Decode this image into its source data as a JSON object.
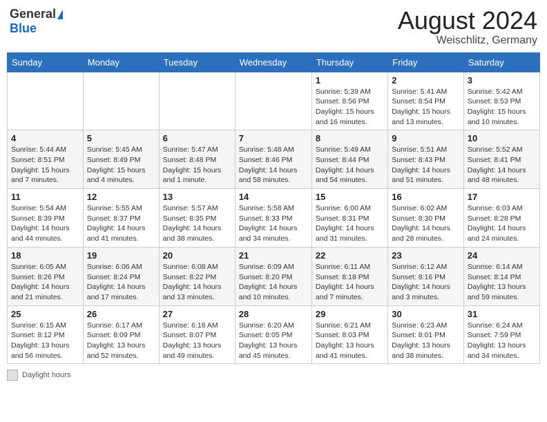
{
  "header": {
    "logo_general": "General",
    "logo_blue": "Blue",
    "month_year": "August 2024",
    "location": "Weischlitz, Germany"
  },
  "footer": {
    "daylight_label": "Daylight hours"
  },
  "weekdays": [
    "Sunday",
    "Monday",
    "Tuesday",
    "Wednesday",
    "Thursday",
    "Friday",
    "Saturday"
  ],
  "weeks": [
    [
      {
        "day": "",
        "sunrise": "",
        "sunset": "",
        "daylight": ""
      },
      {
        "day": "",
        "sunrise": "",
        "sunset": "",
        "daylight": ""
      },
      {
        "day": "",
        "sunrise": "",
        "sunset": "",
        "daylight": ""
      },
      {
        "day": "",
        "sunrise": "",
        "sunset": "",
        "daylight": ""
      },
      {
        "day": "1",
        "sunrise": "5:39 AM",
        "sunset": "8:56 PM",
        "daylight": "15 hours and 16 minutes."
      },
      {
        "day": "2",
        "sunrise": "5:41 AM",
        "sunset": "8:54 PM",
        "daylight": "15 hours and 13 minutes."
      },
      {
        "day": "3",
        "sunrise": "5:42 AM",
        "sunset": "8:53 PM",
        "daylight": "15 hours and 10 minutes."
      }
    ],
    [
      {
        "day": "4",
        "sunrise": "5:44 AM",
        "sunset": "8:51 PM",
        "daylight": "15 hours and 7 minutes."
      },
      {
        "day": "5",
        "sunrise": "5:45 AM",
        "sunset": "8:49 PM",
        "daylight": "15 hours and 4 minutes."
      },
      {
        "day": "6",
        "sunrise": "5:47 AM",
        "sunset": "8:48 PM",
        "daylight": "15 hours and 1 minute."
      },
      {
        "day": "7",
        "sunrise": "5:48 AM",
        "sunset": "8:46 PM",
        "daylight": "14 hours and 58 minutes."
      },
      {
        "day": "8",
        "sunrise": "5:49 AM",
        "sunset": "8:44 PM",
        "daylight": "14 hours and 54 minutes."
      },
      {
        "day": "9",
        "sunrise": "5:51 AM",
        "sunset": "8:43 PM",
        "daylight": "14 hours and 51 minutes."
      },
      {
        "day": "10",
        "sunrise": "5:52 AM",
        "sunset": "8:41 PM",
        "daylight": "14 hours and 48 minutes."
      }
    ],
    [
      {
        "day": "11",
        "sunrise": "5:54 AM",
        "sunset": "8:39 PM",
        "daylight": "14 hours and 44 minutes."
      },
      {
        "day": "12",
        "sunrise": "5:55 AM",
        "sunset": "8:37 PM",
        "daylight": "14 hours and 41 minutes."
      },
      {
        "day": "13",
        "sunrise": "5:57 AM",
        "sunset": "8:35 PM",
        "daylight": "14 hours and 38 minutes."
      },
      {
        "day": "14",
        "sunrise": "5:58 AM",
        "sunset": "8:33 PM",
        "daylight": "14 hours and 34 minutes."
      },
      {
        "day": "15",
        "sunrise": "6:00 AM",
        "sunset": "8:31 PM",
        "daylight": "14 hours and 31 minutes."
      },
      {
        "day": "16",
        "sunrise": "6:02 AM",
        "sunset": "8:30 PM",
        "daylight": "14 hours and 28 minutes."
      },
      {
        "day": "17",
        "sunrise": "6:03 AM",
        "sunset": "8:28 PM",
        "daylight": "14 hours and 24 minutes."
      }
    ],
    [
      {
        "day": "18",
        "sunrise": "6:05 AM",
        "sunset": "8:26 PM",
        "daylight": "14 hours and 21 minutes."
      },
      {
        "day": "19",
        "sunrise": "6:06 AM",
        "sunset": "8:24 PM",
        "daylight": "14 hours and 17 minutes."
      },
      {
        "day": "20",
        "sunrise": "6:08 AM",
        "sunset": "8:22 PM",
        "daylight": "14 hours and 13 minutes."
      },
      {
        "day": "21",
        "sunrise": "6:09 AM",
        "sunset": "8:20 PM",
        "daylight": "14 hours and 10 minutes."
      },
      {
        "day": "22",
        "sunrise": "6:11 AM",
        "sunset": "8:18 PM",
        "daylight": "14 hours and 7 minutes."
      },
      {
        "day": "23",
        "sunrise": "6:12 AM",
        "sunset": "8:16 PM",
        "daylight": "14 hours and 3 minutes."
      },
      {
        "day": "24",
        "sunrise": "6:14 AM",
        "sunset": "8:14 PM",
        "daylight": "13 hours and 59 minutes."
      }
    ],
    [
      {
        "day": "25",
        "sunrise": "6:15 AM",
        "sunset": "8:12 PM",
        "daylight": "13 hours and 56 minutes."
      },
      {
        "day": "26",
        "sunrise": "6:17 AM",
        "sunset": "8:09 PM",
        "daylight": "13 hours and 52 minutes."
      },
      {
        "day": "27",
        "sunrise": "6:18 AM",
        "sunset": "8:07 PM",
        "daylight": "13 hours and 49 minutes."
      },
      {
        "day": "28",
        "sunrise": "6:20 AM",
        "sunset": "8:05 PM",
        "daylight": "13 hours and 45 minutes."
      },
      {
        "day": "29",
        "sunrise": "6:21 AM",
        "sunset": "8:03 PM",
        "daylight": "13 hours and 41 minutes."
      },
      {
        "day": "30",
        "sunrise": "6:23 AM",
        "sunset": "8:01 PM",
        "daylight": "13 hours and 38 minutes."
      },
      {
        "day": "31",
        "sunrise": "6:24 AM",
        "sunset": "7:59 PM",
        "daylight": "13 hours and 34 minutes."
      }
    ]
  ]
}
